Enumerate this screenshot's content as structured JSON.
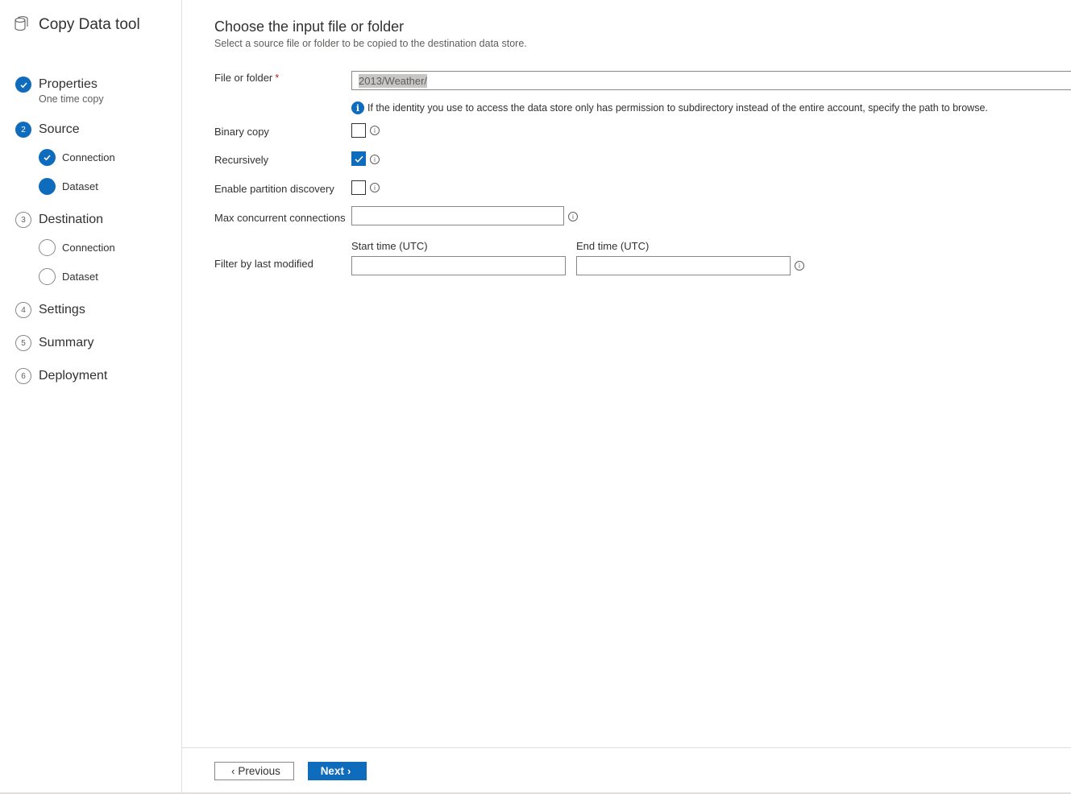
{
  "app": {
    "title": "Copy Data tool",
    "icon": "database-icon"
  },
  "steps": [
    {
      "number": "",
      "label": "Properties",
      "sublabel": "One time copy",
      "state": "done"
    },
    {
      "number": "2",
      "label": "Source",
      "state": "current",
      "children": [
        {
          "label": "Connection",
          "state": "done"
        },
        {
          "label": "Dataset",
          "state": "current"
        }
      ]
    },
    {
      "number": "3",
      "label": "Destination",
      "state": "pending",
      "children": [
        {
          "label": "Connection",
          "state": "pending"
        },
        {
          "label": "Dataset",
          "state": "pending"
        }
      ]
    },
    {
      "number": "4",
      "label": "Settings",
      "state": "pending"
    },
    {
      "number": "5",
      "label": "Summary",
      "state": "pending"
    },
    {
      "number": "6",
      "label": "Deployment",
      "state": "pending"
    }
  ],
  "page": {
    "title": "Choose the input file or folder",
    "subtitle": "Select a source file or folder to be copied to the destination data store."
  },
  "form": {
    "file_or_folder": {
      "label": "File or folder",
      "required_mark": "*",
      "value": "2013/Weather/"
    },
    "info_text": "If the identity you use to access the data store only has permission to subdirectory instead of the entire account, specify the path to browse.",
    "binary_copy": {
      "label": "Binary copy",
      "checked": false
    },
    "recursively": {
      "label": "Recursively",
      "checked": true
    },
    "partition_discovery": {
      "label": "Enable partition discovery",
      "checked": false
    },
    "max_connections": {
      "label": "Max concurrent connections",
      "value": ""
    },
    "filter": {
      "label": "Filter by last modified",
      "start_label": "Start time (UTC)",
      "end_label": "End time (UTC)",
      "start_value": "",
      "end_value": ""
    }
  },
  "footer": {
    "previous_label": "Previous",
    "next_label": "Next"
  },
  "colors": {
    "accent": "#0f6cbd",
    "required": "#a4262c"
  }
}
